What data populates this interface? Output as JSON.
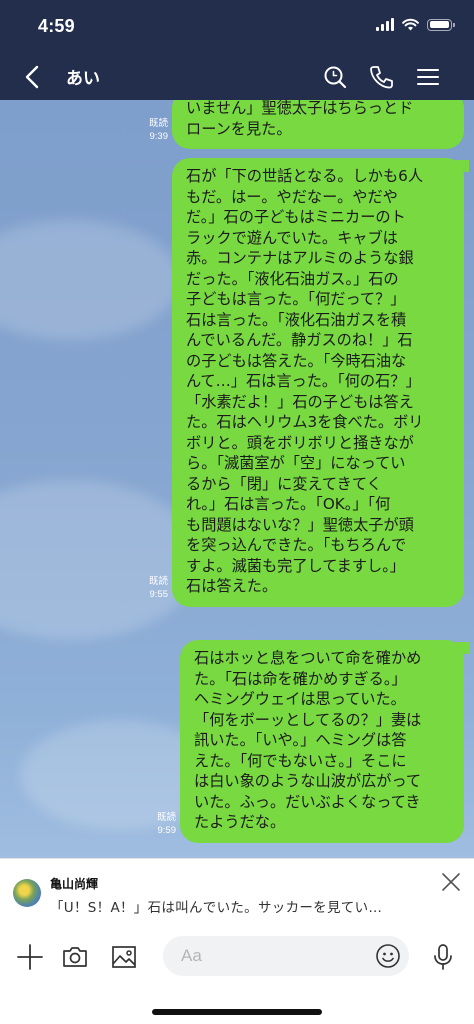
{
  "status_bar": {
    "time": "4:59",
    "battery_level": 0.95
  },
  "header": {
    "title": "あい"
  },
  "messages": [
    {
      "read": "既読",
      "time": "9:39",
      "lines": [
        "いません」聖徳太子はちらっとド",
        "ローンを見た。"
      ]
    },
    {
      "read": "既読",
      "time": "9:55",
      "lines": [
        "石が「下の世話となる。しかも6人",
        "もだ。はー。やだなー。やだや",
        "だ。」石の子どもはミニカーのト",
        "ラックで遊んでいた。キャブは",
        "赤。コンテナはアルミのような銀",
        "だった。「液化石油ガス。」石の",
        "子どもは言った。「何だって？」",
        "石は言った。「液化石油ガスを積",
        "んでいるんだ。静ガスのね！」石",
        "の子どもは答えた。「今時石油な",
        "んて…」石は言った。「何の石？」",
        "「水素だよ！」石の子どもは答え",
        "た。石はヘリウム3を食べた。ボリ",
        "ボリと。頭をボリボリと掻きなが",
        "ら。「滅菌室が「空」になってい",
        "るから「閉」に変えてきてく",
        "れ。」石は言った。「OK。」「何",
        "も問題はないな？」聖徳太子が頭",
        "を突っ込んできた。「もちろんで",
        "すよ。滅菌も完了してますし。」",
        "石は答えた。"
      ]
    },
    {
      "read": "既読",
      "time": "9:59",
      "lines": [
        "石はホッと息をついて命を確かめ",
        "た。「石は命を確かめすぎる。」",
        "ヘミングウェイは思っていた。",
        "「何をボーッとしてるの？」妻は",
        "訊いた。「いや。」ヘミングは答",
        "えた。「何でもないさ。」そこに",
        "は白い象のような山波が広がって",
        "いた。ふっ。だいぶよくなってき",
        "たようだな。"
      ]
    }
  ],
  "notification": {
    "sender": "亀山尚輝",
    "preview": "「U！S！A！」石は叫んでいた。サッカーを見てい…"
  },
  "input": {
    "placeholder": "Aa"
  },
  "colors": {
    "header_bg": "#232e4d",
    "bubble": "#78d940",
    "chat_bg": "#86a5d0"
  },
  "icons": [
    "back-icon",
    "search-icon",
    "phone-icon",
    "menu-icon",
    "close-icon",
    "plus-icon",
    "camera-icon",
    "image-icon",
    "emoji-icon",
    "mic-icon"
  ]
}
